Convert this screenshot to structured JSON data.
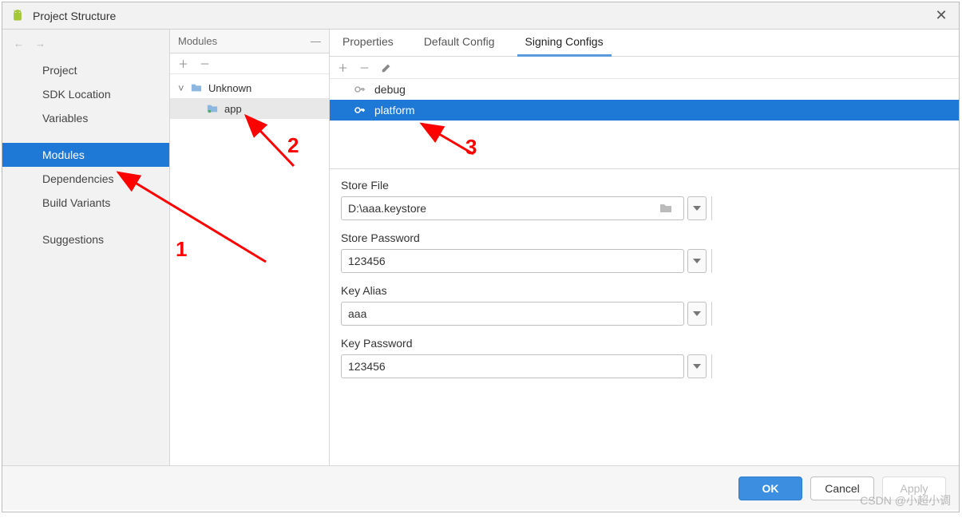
{
  "window": {
    "title": "Project Structure"
  },
  "leftnav": {
    "items": [
      {
        "label": "Project"
      },
      {
        "label": "SDK Location"
      },
      {
        "label": "Variables"
      },
      {
        "label": "Modules",
        "selected": true
      },
      {
        "label": "Dependencies"
      },
      {
        "label": "Build Variants"
      },
      {
        "label": "Suggestions"
      }
    ]
  },
  "modules": {
    "header": "Modules",
    "tree": {
      "root": {
        "label": "Unknown"
      },
      "children": [
        {
          "label": "app",
          "selected": true
        }
      ]
    }
  },
  "tabs": {
    "items": [
      {
        "label": "Properties"
      },
      {
        "label": "Default Config"
      },
      {
        "label": "Signing Configs",
        "active": true
      }
    ]
  },
  "signing_configs": {
    "items": [
      {
        "label": "debug"
      },
      {
        "label": "platform",
        "selected": true
      }
    ]
  },
  "form": {
    "store_file": {
      "label": "Store File",
      "value": "D:\\aaa.keystore"
    },
    "store_password": {
      "label": "Store Password",
      "value": "123456"
    },
    "key_alias": {
      "label": "Key Alias",
      "value": "aaa"
    },
    "key_password": {
      "label": "Key Password",
      "value": "123456"
    }
  },
  "footer": {
    "ok": "OK",
    "cancel": "Cancel",
    "apply": "Apply"
  },
  "annotations": {
    "a1": "1",
    "a2": "2",
    "a3": "3"
  },
  "watermark": "CSDN @小超小调"
}
